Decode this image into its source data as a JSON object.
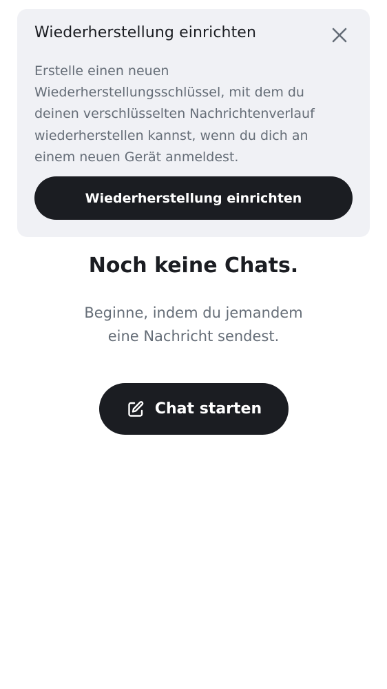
{
  "recovery_card": {
    "title": "Wiederherstellung einrichten",
    "body_lines": [
      "Erstelle einen neuen",
      "Wiederherstellungsschlüssel, mit dem du",
      "deinen verschlüsselten Nachrichtenverlauf",
      "wiederherstellen kannst, wenn du dich an",
      "einem neuen Gerät anmeldest."
    ],
    "button_label": "Wiederherstellung einrichten",
    "close_icon": "close-icon"
  },
  "empty_state": {
    "title": "Noch keine Chats.",
    "subtitle_lines": [
      "Beginne, indem du jemandem",
      "eine Nachricht sendest."
    ],
    "button_label": "Chat starten",
    "button_icon": "compose-icon"
  },
  "colors": {
    "card_background": "#f0f1f5",
    "primary_button": "#1b1d22",
    "primary_text": "#1b1d22",
    "secondary_text": "#656d77",
    "page_background": "#ffffff"
  }
}
